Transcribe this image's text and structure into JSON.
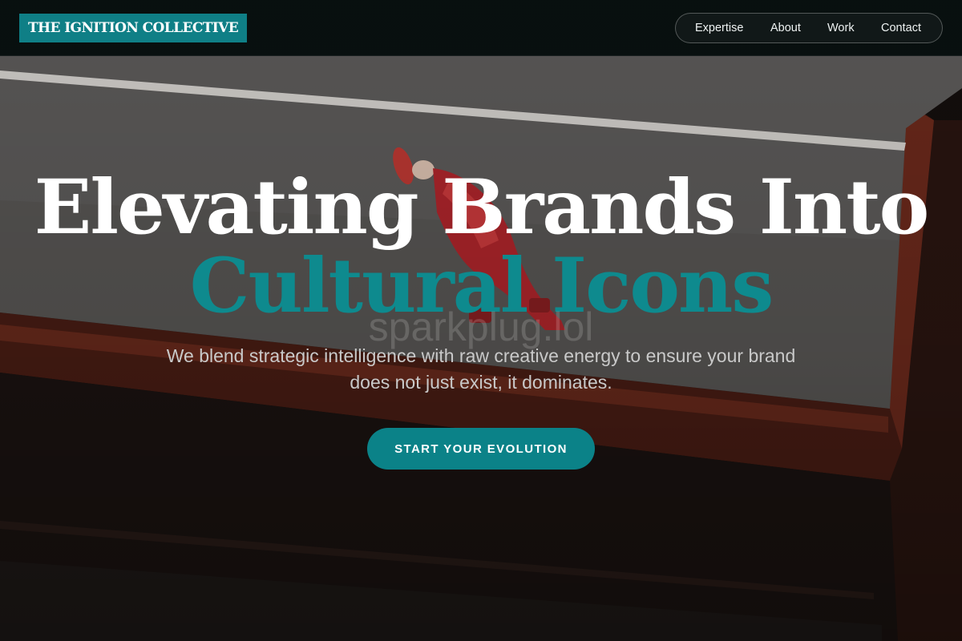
{
  "header": {
    "logo_text": "THE IGNITION COLLECTIVE",
    "nav": [
      {
        "label": "Expertise"
      },
      {
        "label": "About"
      },
      {
        "label": "Work"
      },
      {
        "label": "Contact"
      }
    ]
  },
  "hero": {
    "title_line_1": "Elevating Brands Into",
    "title_line_2": "Cultural Icons",
    "subtitle": "We blend strategic intelligence with raw creative energy to ensure your brand does not just exist, it dominates.",
    "cta_label": "START YOUR EVOLUTION",
    "watermark_text": "sparkplug.lol"
  },
  "colors": {
    "accent": "#0f7f86",
    "header_bg": "#081010",
    "title_white": "#ffffff",
    "title_accent": "#0e8a8e",
    "subtitle": "#c9c9c9"
  },
  "images": {
    "hero_background": "photo-concrete-platform-figure-in-red"
  }
}
